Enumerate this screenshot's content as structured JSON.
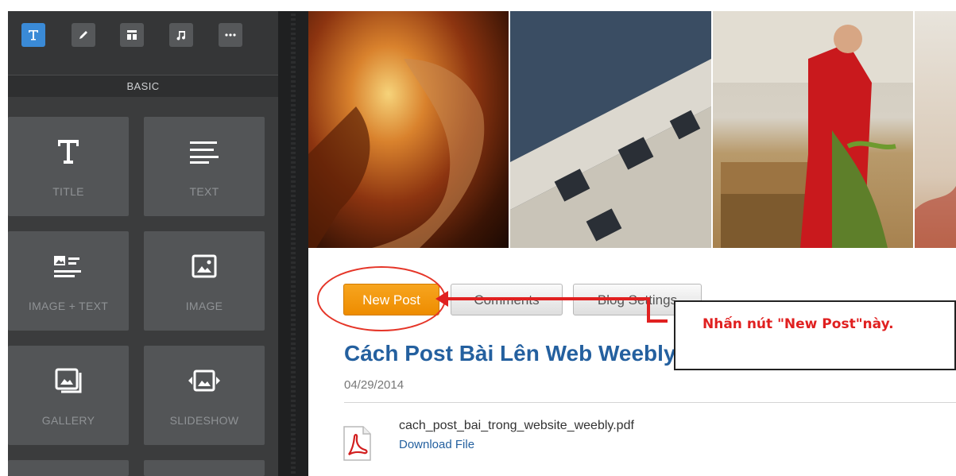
{
  "editor": {
    "toolbar": [
      {
        "icon": "text-tool-icon",
        "active": true
      },
      {
        "icon": "pencil-icon",
        "active": false
      },
      {
        "icon": "layout-icon",
        "active": false
      },
      {
        "icon": "music-note-icon",
        "active": false
      },
      {
        "icon": "more-dots-icon",
        "active": false
      }
    ],
    "section_label": "BASIC",
    "tiles": [
      {
        "label": "TITLE",
        "icon": "title-t-icon"
      },
      {
        "label": "TEXT",
        "icon": "text-lines-icon"
      },
      {
        "label": "IMAGE + TEXT",
        "icon": "image-text-icon"
      },
      {
        "label": "IMAGE",
        "icon": "image-icon"
      },
      {
        "label": "GALLERY",
        "icon": "gallery-icon"
      },
      {
        "label": "SLIDESHOW",
        "icon": "slideshow-icon"
      }
    ]
  },
  "blog": {
    "buttons": {
      "new_post": "New Post",
      "comments": "Comments",
      "settings": "Blog Settings"
    },
    "post": {
      "title": "Cách Post Bài Lên Web Weebly",
      "date": "04/29/2014",
      "file_name": "cach_post_bai_trong_website_weebly.pdf",
      "file_link": "Download File",
      "file_icon": "pdf-icon"
    }
  },
  "annotation": {
    "text": "Nhấn nút \"New Post\"này.",
    "color": "#e02020"
  },
  "colors": {
    "accent_blue": "#3a8ad6",
    "new_post_orange": "#f39a10",
    "title_blue": "#24609f",
    "panel_dark": "#3a3b3c"
  }
}
